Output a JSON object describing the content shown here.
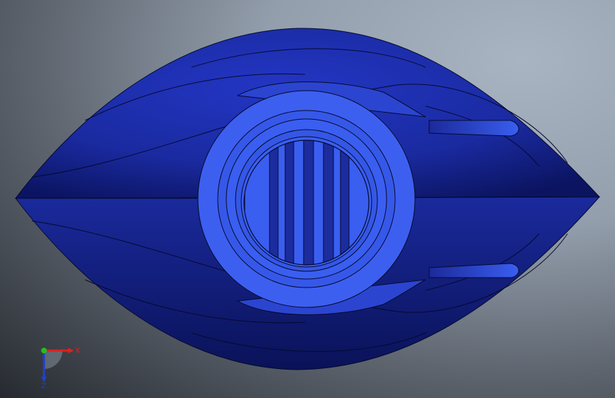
{
  "viewport": {
    "background_center": "#a9b4c2",
    "background_edge": "#262a30"
  },
  "model": {
    "body_color": "#1e2fa8",
    "body_dark": "#0d1868",
    "face_color": "#3a5ef0",
    "edge_color": "#050a30"
  },
  "triad": {
    "x_label": "X",
    "z_label": "Z",
    "x_color": "#e02020",
    "y_color": "#20c020",
    "z_color": "#2040d0"
  }
}
